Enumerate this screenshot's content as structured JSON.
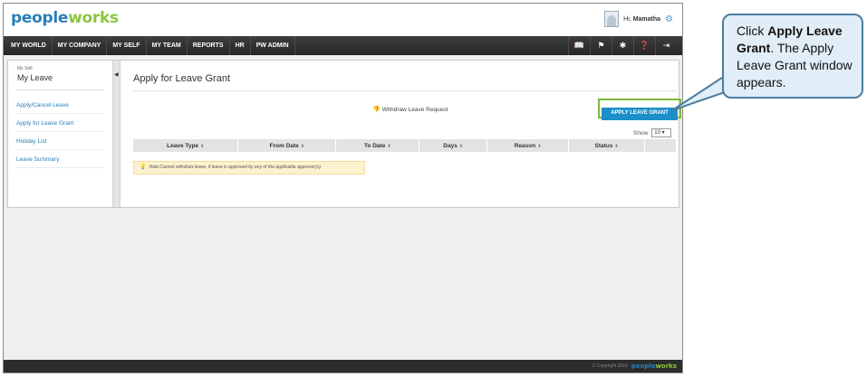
{
  "brand": {
    "logo_part1": "pe",
    "logo_part2": "ople",
    "logo_part3": "w",
    "logo_part4": "orks"
  },
  "user": {
    "greeting": "Hi,",
    "name": "Mamatha"
  },
  "nav": {
    "items": [
      "MY WORLD",
      "MY COMPANY",
      "MY SELF",
      "MY TEAM",
      "REPORTS",
      "HR",
      "PW ADMIN"
    ],
    "icons": [
      "book-icon",
      "flag-icon",
      "tools-icon",
      "help-icon",
      "exit-icon"
    ]
  },
  "sidebar": {
    "section_small": "My Self",
    "section": "My Leave",
    "items": [
      "Apply/Cancel Leave",
      "Apply for Leave Grant",
      "Holiday List",
      "Leave Summary"
    ]
  },
  "main": {
    "title": "Apply for Leave Grant",
    "withdraw_label": "Withdraw Leave Request",
    "grant_button": "APPLY LEAVE GRANT",
    "show_label": "Show",
    "show_value": "10",
    "columns": [
      "Leave Type",
      "From Date",
      "To Date",
      "Days",
      "Reason",
      "Status"
    ],
    "note": "Note:Cannot withdraw leave, if leave is approved by any of the applicable approver(s)."
  },
  "footer": {
    "copyright": "© Copyright 2015"
  },
  "callout": {
    "prefix": "Click ",
    "bold": "Apply Leave Grant",
    "suffix": ". The Apply Leave Grant window appears."
  },
  "colors": {
    "accent": "#1c8fc9",
    "highlight": "#7db83a",
    "nav_bg": "#2c2c2c",
    "callout_bg": "#e1eef7"
  }
}
